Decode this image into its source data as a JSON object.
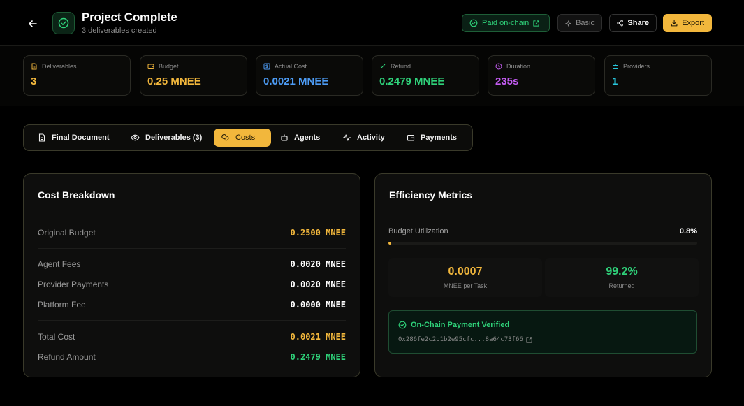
{
  "header": {
    "title": "Project Complete",
    "subtitle": "3 deliverables created",
    "buttons": {
      "paid": "Paid on-chain",
      "basic": "Basic",
      "share": "Share",
      "export": "Export"
    }
  },
  "stats": [
    {
      "label": "Deliverables",
      "value": "3",
      "color": "#f2b73c",
      "icon": "document-icon"
    },
    {
      "label": "Budget",
      "value": "0.25 MNEE",
      "color": "#f2b73c",
      "icon": "wallet-icon"
    },
    {
      "label": "Actual Cost",
      "value": "0.0021 MNEE",
      "color": "#4d9cf5",
      "icon": "dollar-icon"
    },
    {
      "label": "Refund",
      "value": "0.2479 MNEE",
      "color": "#2fd27a",
      "icon": "arrow-down-left-icon"
    },
    {
      "label": "Duration",
      "value": "235s",
      "color": "#c45cf2",
      "icon": "clock-icon"
    },
    {
      "label": "Providers",
      "value": "1",
      "color": "#28c6dc",
      "icon": "bot-icon"
    }
  ],
  "tabs": [
    {
      "label": "Final Document",
      "icon": "document-icon"
    },
    {
      "label": "Deliverables (3)",
      "icon": "eye-icon"
    },
    {
      "label": "Costs",
      "icon": "coins-icon",
      "active": true
    },
    {
      "label": "Agents",
      "icon": "bot-icon"
    },
    {
      "label": "Activity",
      "icon": "activity-icon"
    },
    {
      "label": "Payments",
      "icon": "wallet-icon"
    }
  ],
  "cost_breakdown": {
    "title": "Cost Breakdown",
    "rows": [
      {
        "label": "Original Budget",
        "value": "0.2500 MNEE",
        "color": "#f2b73c"
      },
      {
        "label": "Agent Fees",
        "value": "0.0020 MNEE",
        "color": "#ffffff"
      },
      {
        "label": "Provider Payments",
        "value": "0.0020 MNEE",
        "color": "#ffffff"
      },
      {
        "label": "Platform Fee",
        "value": "0.0000 MNEE",
        "color": "#ffffff"
      },
      {
        "label": "Total Cost",
        "value": "0.0021 MNEE",
        "color": "#f2b73c"
      },
      {
        "label": "Refund Amount",
        "value": "0.2479 MNEE",
        "color": "#2fd27a"
      }
    ]
  },
  "efficiency": {
    "title": "Efficiency Metrics",
    "utilization_label": "Budget Utilization",
    "utilization_value": "0.8%",
    "utilization_fraction": 0.008,
    "metrics": [
      {
        "value": "0.0007",
        "caption": "MNEE per Task",
        "color": "#f2b73c"
      },
      {
        "value": "99.2%",
        "caption": "Returned",
        "color": "#2fd27a"
      }
    ],
    "verify_title": "On-Chain Payment Verified",
    "tx_hash": "0x286fe2c2b1b2e95cfc...8a64c73f66"
  }
}
